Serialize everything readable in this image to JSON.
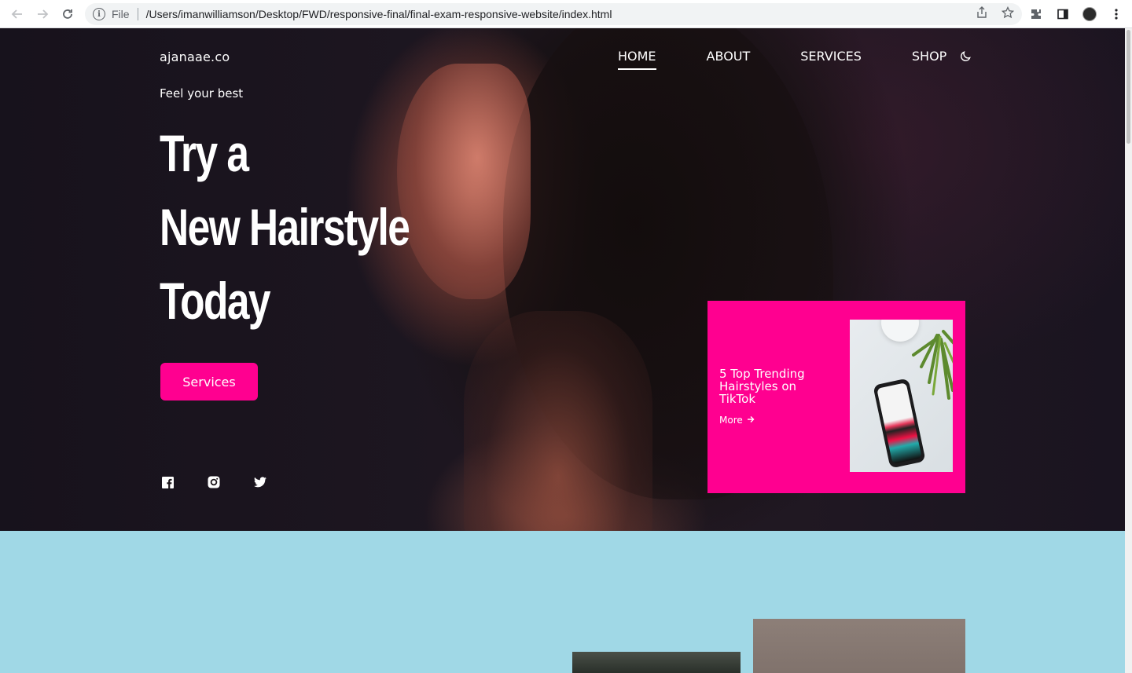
{
  "browser": {
    "file_label": "File",
    "url": "/Users/imanwilliamson/Desktop/FWD/responsive-final/final-exam-responsive-website/index.html"
  },
  "site": {
    "logo": "ajanaae.co",
    "nav": {
      "home": "HOME",
      "about": "ABOUT",
      "services": "SERVICES",
      "shop": "SHOP"
    }
  },
  "hero": {
    "tagline": "Feel your best",
    "headline_line1": "Try a",
    "headline_line2": "New Hairstyle",
    "headline_line3": "Today",
    "cta_label": "Services"
  },
  "feature_card": {
    "title": "5 Top Trending Hairstyles on TikTok",
    "more_label": "More"
  },
  "colors": {
    "accent": "#ff0090",
    "lower_section_bg": "#a0d8e6"
  },
  "icons": [
    "back-icon",
    "forward-icon",
    "reload-icon",
    "info-icon",
    "share-icon",
    "star-icon",
    "extensions-icon",
    "side-panel-icon",
    "profile-avatar",
    "menu-icon",
    "moon-icon",
    "facebook-icon",
    "instagram-icon",
    "twitter-icon",
    "arrow-right-icon"
  ]
}
